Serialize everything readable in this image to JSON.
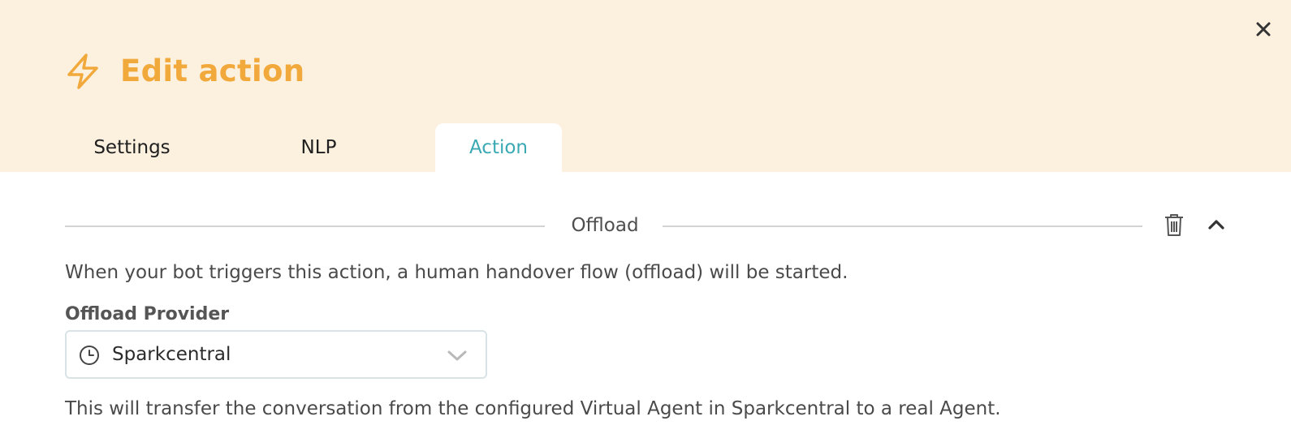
{
  "header": {
    "title": "Edit action",
    "title_icon": "lightning-bolt-icon",
    "close_icon": "close-icon",
    "accent_color": "#f2a93b",
    "background_color": "#fcf0df"
  },
  "tabs": [
    {
      "label": "Settings",
      "active": false
    },
    {
      "label": "NLP",
      "active": false
    },
    {
      "label": "Action",
      "active": true,
      "color": "#3aa9b4"
    }
  ],
  "section": {
    "title": "Offload",
    "delete_icon": "trash-icon",
    "collapse_icon": "chevron-up-icon",
    "description": "When your bot triggers this action, a human handover flow (offload) will be started."
  },
  "offload_provider": {
    "label": "Offload Provider",
    "selected": "Sparkcentral",
    "icon": "clock-icon",
    "dropdown_icon": "chevron-down-icon",
    "note": "This will transfer the conversation from the configured Virtual Agent in Sparkcentral to a real Agent."
  }
}
